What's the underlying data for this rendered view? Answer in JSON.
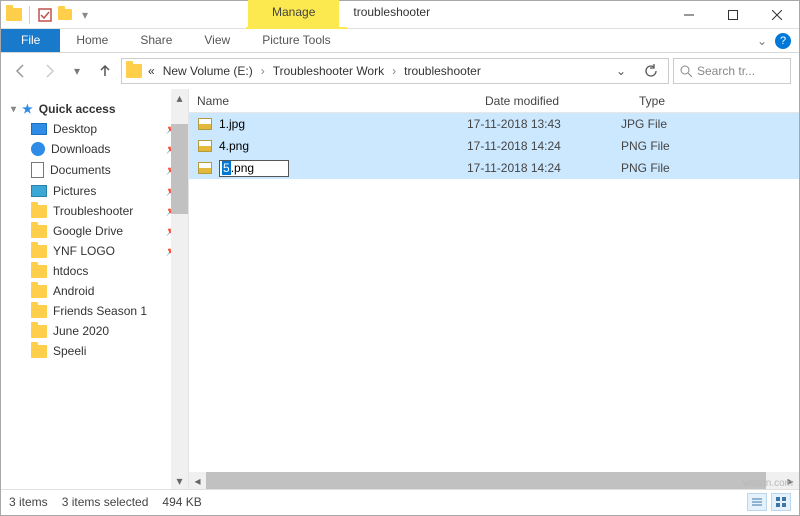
{
  "titlebar": {
    "context_tab": "Manage",
    "window_title": "troubleshooter"
  },
  "ribbon": {
    "file": "File",
    "tabs": [
      "Home",
      "Share",
      "View"
    ],
    "context_tool": "Picture Tools"
  },
  "nav": {
    "crumb_prefix": "«",
    "crumbs": [
      "New Volume (E:)",
      "Troubleshooter Work",
      "troubleshooter"
    ],
    "search_placeholder": "Search tr..."
  },
  "navpane": {
    "quick_access": "Quick access",
    "items": [
      {
        "label": "Desktop",
        "pinned": true,
        "icon": "desktop"
      },
      {
        "label": "Downloads",
        "pinned": true,
        "icon": "download"
      },
      {
        "label": "Documents",
        "pinned": true,
        "icon": "document"
      },
      {
        "label": "Pictures",
        "pinned": true,
        "icon": "picture"
      },
      {
        "label": "Troubleshooter",
        "pinned": true,
        "icon": "folder"
      },
      {
        "label": "Google Drive",
        "pinned": true,
        "icon": "folder"
      },
      {
        "label": "YNF LOGO",
        "pinned": true,
        "icon": "folder"
      },
      {
        "label": "htdocs",
        "pinned": false,
        "icon": "folder"
      },
      {
        "label": "Android",
        "pinned": false,
        "icon": "folder"
      },
      {
        "label": "Friends Season 1",
        "pinned": false,
        "icon": "folder"
      },
      {
        "label": "June 2020",
        "pinned": false,
        "icon": "folder"
      },
      {
        "label": "Speeli",
        "pinned": false,
        "icon": "folder"
      }
    ]
  },
  "columns": {
    "name": "Name",
    "date": "Date modified",
    "type": "Type"
  },
  "files": [
    {
      "name": "1.jpg",
      "date": "17-11-2018 13:43",
      "type": "JPG File",
      "renaming": false
    },
    {
      "name": "4.png",
      "date": "17-11-2018 14:24",
      "type": "PNG File",
      "renaming": false
    },
    {
      "name_sel": "5",
      "name_rest": ".png",
      "date": "17-11-2018 14:24",
      "type": "PNG File",
      "renaming": true
    }
  ],
  "status": {
    "count": "3 items",
    "selected": "3 items selected",
    "size": "494 KB"
  },
  "watermark": "wsxdn.com"
}
